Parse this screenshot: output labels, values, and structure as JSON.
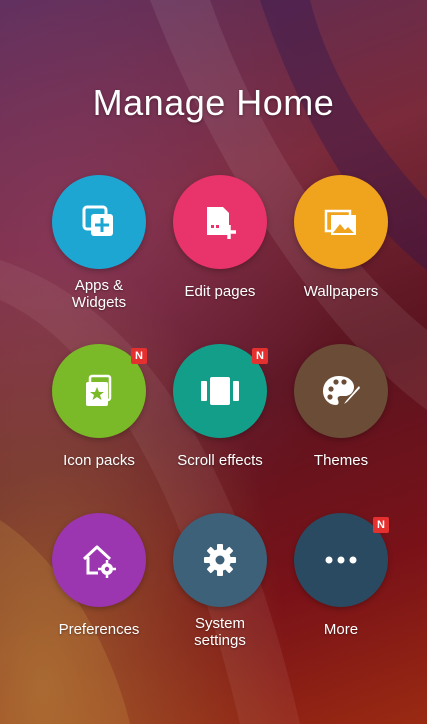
{
  "page": {
    "title": "Manage Home"
  },
  "tiles": [
    {
      "label": "Apps &\nWidgets",
      "color": "#1ea6d3",
      "icon": "apps-widgets-icon",
      "badge": ""
    },
    {
      "label": "Edit pages",
      "color": "#e8336b",
      "icon": "edit-pages-icon",
      "badge": ""
    },
    {
      "label": "Wallpapers",
      "color": "#f0a31c",
      "icon": "wallpapers-icon",
      "badge": ""
    },
    {
      "label": "Icon packs",
      "color": "#7ab927",
      "icon": "icon-packs-icon",
      "badge": "N"
    },
    {
      "label": "Scroll effects",
      "color": "#139e8a",
      "icon": "scroll-effects-icon",
      "badge": "N"
    },
    {
      "label": "Themes",
      "color": "#6b4c36",
      "icon": "palette-icon",
      "badge": ""
    },
    {
      "label": "Preferences",
      "color": "#9b35b0",
      "icon": "home-settings-icon",
      "badge": ""
    },
    {
      "label": "System\nsettings",
      "color": "#3d6179",
      "icon": "gear-icon",
      "badge": ""
    },
    {
      "label": "More",
      "color": "#294a60",
      "icon": "more-icon",
      "badge": "N"
    }
  ]
}
